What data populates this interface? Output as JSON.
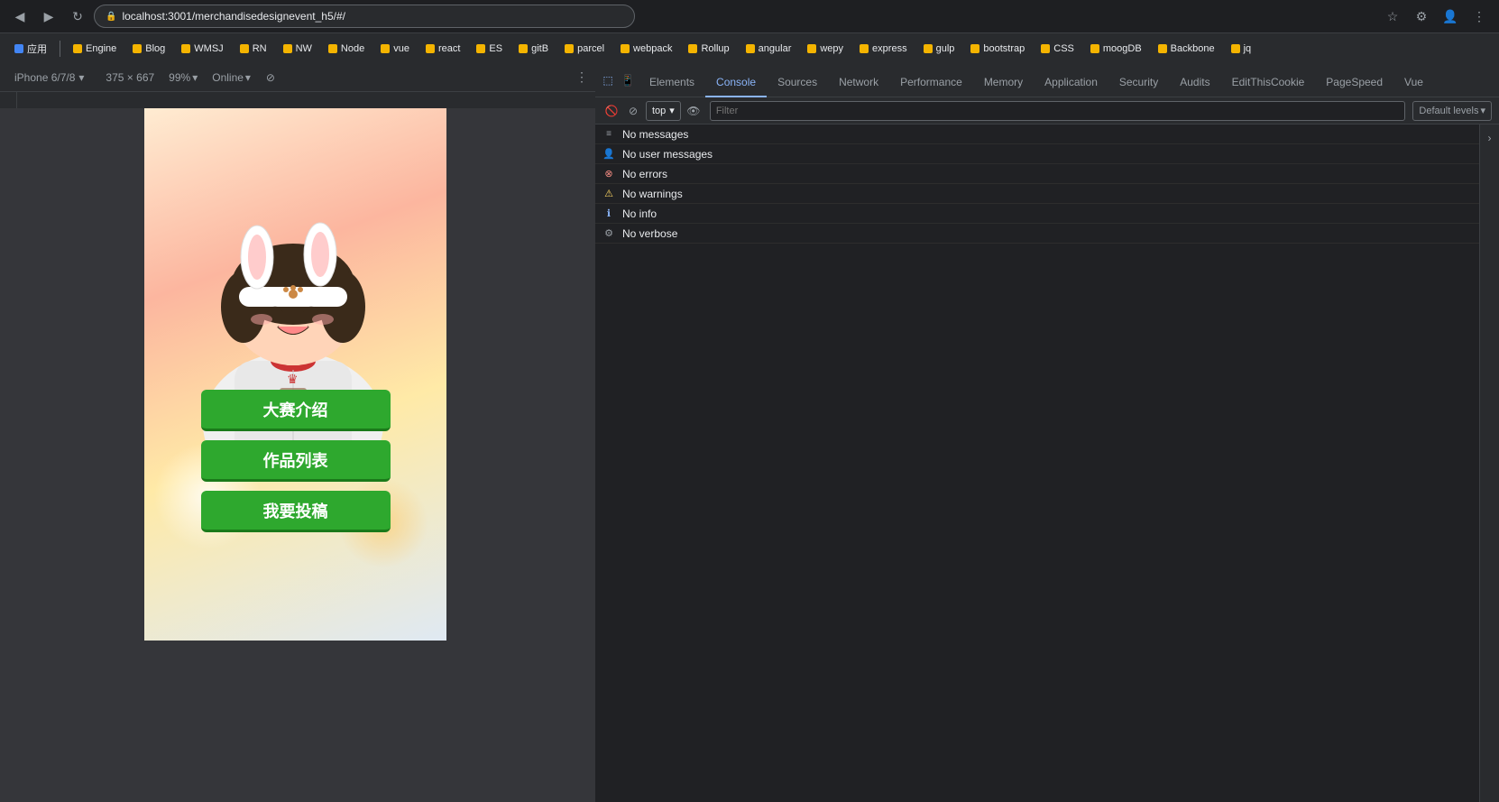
{
  "browser": {
    "address": "localhost:3001/merchandisedesignevent_h5/#/",
    "back_icon": "◀",
    "forward_icon": "▶",
    "refresh_icon": "↻",
    "star_icon": "☆"
  },
  "bookmarks": [
    {
      "label": "应用",
      "color": "#4285F4"
    },
    {
      "label": "Engine",
      "color": "#F4B400"
    },
    {
      "label": "Blog",
      "color": "#F4B400"
    },
    {
      "label": "WMSJ",
      "color": "#F4B400"
    },
    {
      "label": "RN",
      "color": "#F4B400"
    },
    {
      "label": "NW",
      "color": "#F4B400"
    },
    {
      "label": "Node",
      "color": "#F4B400"
    },
    {
      "label": "vue",
      "color": "#F4B400"
    },
    {
      "label": "react",
      "color": "#F4B400"
    },
    {
      "label": "ES",
      "color": "#F4B400"
    },
    {
      "label": "gitB",
      "color": "#F4B400"
    },
    {
      "label": "parcel",
      "color": "#F4B400"
    },
    {
      "label": "webpack",
      "color": "#F4B400"
    },
    {
      "label": "Rollup",
      "color": "#F4B400"
    },
    {
      "label": "angular",
      "color": "#F4B400"
    },
    {
      "label": "wepy",
      "color": "#F4B400"
    },
    {
      "label": "express",
      "color": "#F4B400"
    },
    {
      "label": "gulp",
      "color": "#F4B400"
    },
    {
      "label": "bootstrap",
      "color": "#F4B400"
    },
    {
      "label": "CSS",
      "color": "#F4B400"
    },
    {
      "label": "moogDB",
      "color": "#F4B400"
    },
    {
      "label": "Backbone",
      "color": "#F4B400"
    },
    {
      "label": "jq",
      "color": "#F4B400"
    }
  ],
  "devtools": {
    "device": "iPhone 6/7/8",
    "width": "375",
    "height": "667",
    "zoom": "99%",
    "network": "Online",
    "tabs": [
      {
        "label": "Elements",
        "active": false
      },
      {
        "label": "Console",
        "active": true
      },
      {
        "label": "Sources",
        "active": false
      },
      {
        "label": "Network",
        "active": false
      },
      {
        "label": "Performance",
        "active": false
      },
      {
        "label": "Memory",
        "active": false
      },
      {
        "label": "Application",
        "active": false
      },
      {
        "label": "Security",
        "active": false
      },
      {
        "label": "Audits",
        "active": false
      },
      {
        "label": "EditThisCookie",
        "active": false
      },
      {
        "label": "PageSpeed",
        "active": false
      },
      {
        "label": "Vue",
        "active": false
      }
    ],
    "context": "top",
    "filter_placeholder": "Filter",
    "levels": "Default levels",
    "messages": [
      {
        "type": "messages",
        "text": "No messages"
      },
      {
        "type": "user",
        "text": "No user messages"
      },
      {
        "type": "error",
        "text": "No errors"
      },
      {
        "type": "warning",
        "text": "No warnings"
      },
      {
        "type": "info",
        "text": "No info"
      },
      {
        "type": "verbose",
        "text": "No verbose"
      }
    ]
  },
  "mobile_app": {
    "buttons": [
      {
        "label": "大赛介绍"
      },
      {
        "label": "作品列表"
      },
      {
        "label": "我要投稿"
      }
    ]
  }
}
